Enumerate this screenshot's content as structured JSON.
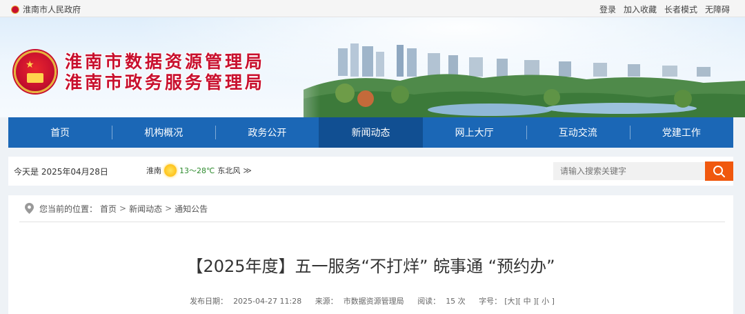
{
  "topbar": {
    "site_name": "淮南市人民政府",
    "links": [
      "登录",
      "加入收藏",
      "长者模式",
      "无障碍"
    ]
  },
  "banner": {
    "title_line1": "淮南市数据资源管理局",
    "title_line2": "淮南市政务服务管理局"
  },
  "nav": {
    "items": [
      "首页",
      "机构概况",
      "政务公开",
      "新闻动态",
      "网上大厅",
      "互动交流",
      "党建工作"
    ],
    "active": "新闻动态"
  },
  "infobar": {
    "date": "今天是 2025年04月28日",
    "city": "淮南",
    "temperature": "13～28℃",
    "wind": "东北风",
    "wind_arrow": "≫",
    "search_placeholder": "请输入搜索关键字"
  },
  "breadcrumb": {
    "prefix": "您当前的位置：",
    "items": [
      "首页",
      "新闻动态",
      "通知公告"
    ],
    "separator": ">"
  },
  "article": {
    "title": "【2025年度】五一服务“不打烊” 皖事通 “预约办”",
    "publish_label": "发布日期：",
    "publish_date": "2025-04-27 11:28",
    "source_label": "来源：",
    "source": "市数据资源管理局",
    "reads_label": "阅读：",
    "reads": "15 次",
    "font_label": "字号：",
    "font_large": "[大]",
    "font_medium": "[ 中 ]",
    "font_small": "[ 小 ]"
  },
  "colors": {
    "nav_blue": "#1b67b6",
    "nav_active": "#114f92",
    "title_red": "#c8102e",
    "search_orange": "#f0580e"
  }
}
